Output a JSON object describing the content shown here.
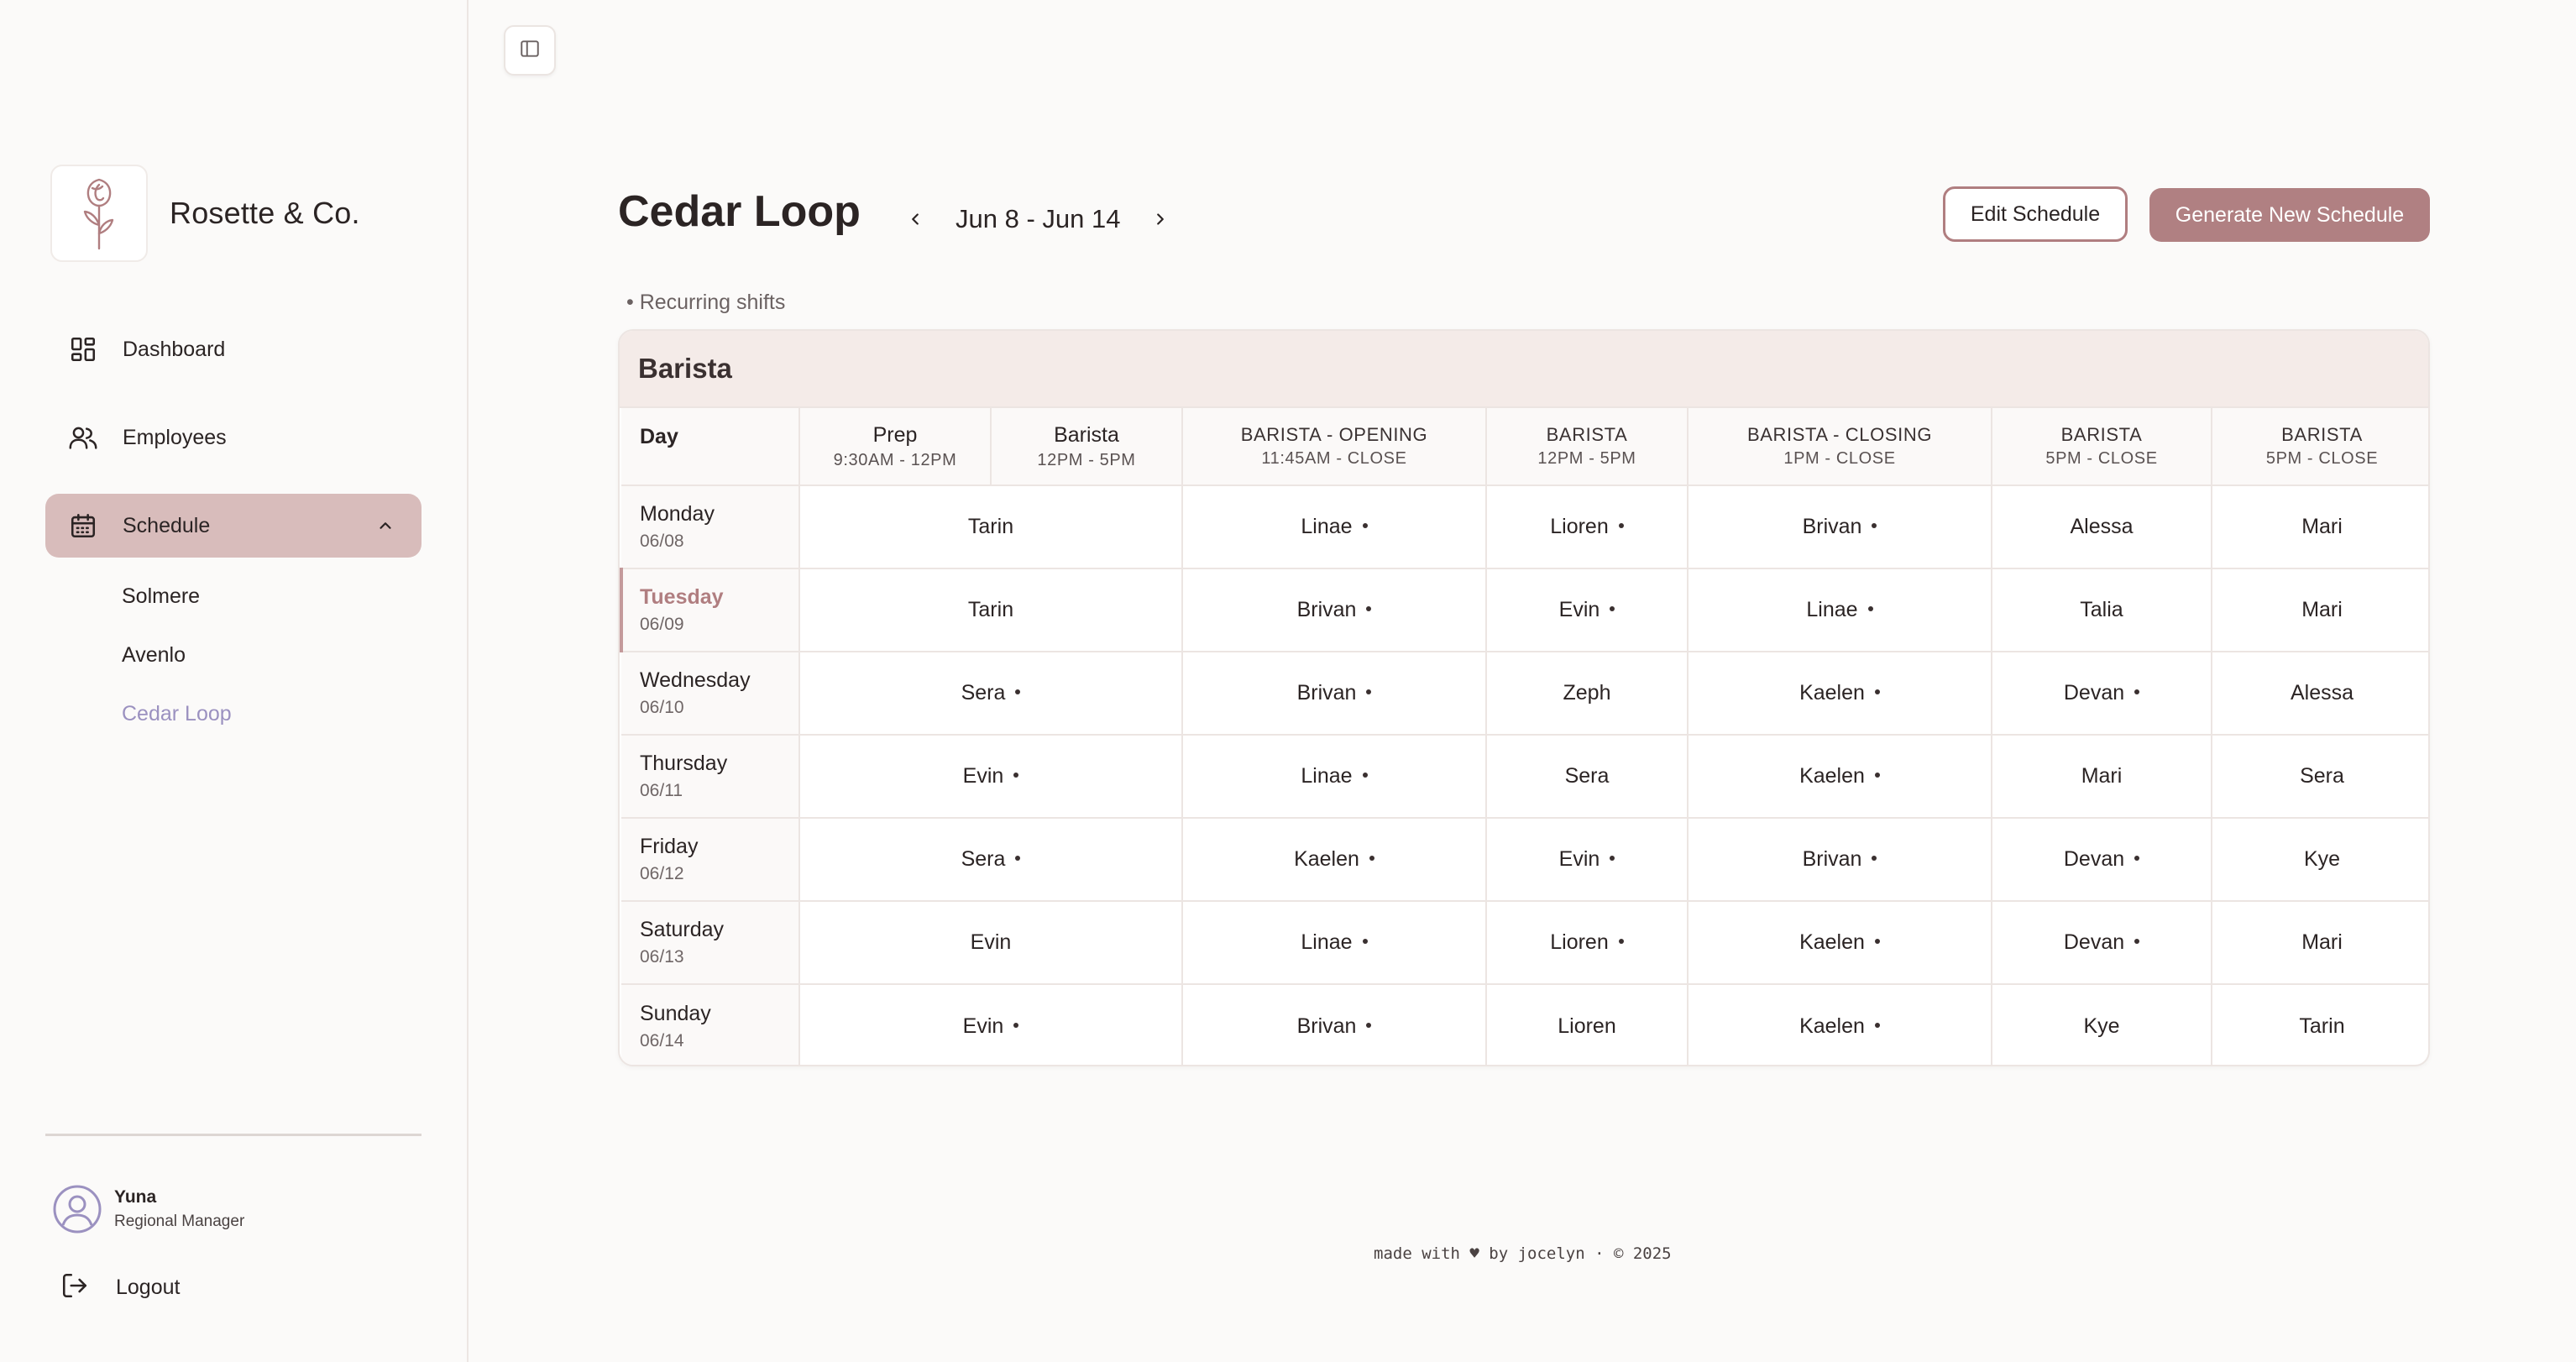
{
  "brand": {
    "name": "Rosette & Co."
  },
  "nav": {
    "items": [
      {
        "label": "Dashboard",
        "icon": "dashboard-icon"
      },
      {
        "label": "Employees",
        "icon": "users-icon"
      },
      {
        "label": "Schedule",
        "icon": "calendar-icon",
        "expanded": true
      }
    ],
    "sub_items": [
      {
        "label": "Solmere"
      },
      {
        "label": "Avenlo"
      },
      {
        "label": "Cedar Loop",
        "current": true
      }
    ]
  },
  "user": {
    "name": "Yuna",
    "role": "Regional Manager"
  },
  "logout": {
    "label": "Logout"
  },
  "header": {
    "title": "Cedar Loop",
    "week": "Jun 8 - Jun 14",
    "edit_label": "Edit Schedule",
    "generate_label": "Generate New Schedule",
    "recurring_note": "• Recurring shifts"
  },
  "colors": {
    "accent": "#b08082",
    "active_nav": "#d8bcbb",
    "current_sub": "#9b91c0",
    "card_head": "#f4ebe8"
  },
  "schedule": {
    "section": "Barista",
    "day_header": "Day",
    "columns": [
      {
        "title": "Prep",
        "time": "9:30AM - 12PM"
      },
      {
        "title": "Barista",
        "time": "12PM - 5PM"
      },
      {
        "title": "BARISTA - OPENING",
        "time": "11:45AM - CLOSE"
      },
      {
        "title": "BARISTA",
        "time": "12PM - 5PM"
      },
      {
        "title": "BARISTA - CLOSING",
        "time": "1PM - CLOSE"
      },
      {
        "title": "BARISTA",
        "time": "5PM - CLOSE"
      },
      {
        "title": "BARISTA",
        "time": "5PM - CLOSE"
      }
    ],
    "rows": [
      {
        "day": "Monday",
        "date": "06/08",
        "today": false,
        "cells": [
          {
            "name": "Tarin",
            "recurring": false
          },
          {
            "name": "Linae",
            "recurring": true
          },
          {
            "name": "Lioren",
            "recurring": true
          },
          {
            "name": "Brivan",
            "recurring": true
          },
          {
            "name": "Alessa",
            "recurring": false
          },
          {
            "name": "Mari",
            "recurring": false
          }
        ]
      },
      {
        "day": "Tuesday",
        "date": "06/09",
        "today": true,
        "cells": [
          {
            "name": "Tarin",
            "recurring": false
          },
          {
            "name": "Brivan",
            "recurring": true
          },
          {
            "name": "Evin",
            "recurring": true
          },
          {
            "name": "Linae",
            "recurring": true
          },
          {
            "name": "Talia",
            "recurring": false
          },
          {
            "name": "Mari",
            "recurring": false
          }
        ]
      },
      {
        "day": "Wednesday",
        "date": "06/10",
        "today": false,
        "cells": [
          {
            "name": "Sera",
            "recurring": true
          },
          {
            "name": "Brivan",
            "recurring": true
          },
          {
            "name": "Zeph",
            "recurring": false
          },
          {
            "name": "Kaelen",
            "recurring": true
          },
          {
            "name": "Devan",
            "recurring": true
          },
          {
            "name": "Alessa",
            "recurring": false
          }
        ]
      },
      {
        "day": "Thursday",
        "date": "06/11",
        "today": false,
        "cells": [
          {
            "name": "Evin",
            "recurring": true
          },
          {
            "name": "Linae",
            "recurring": true
          },
          {
            "name": "Sera",
            "recurring": false
          },
          {
            "name": "Kaelen",
            "recurring": true
          },
          {
            "name": "Mari",
            "recurring": false
          },
          {
            "name": "Sera",
            "recurring": false
          }
        ]
      },
      {
        "day": "Friday",
        "date": "06/12",
        "today": false,
        "cells": [
          {
            "name": "Sera",
            "recurring": true
          },
          {
            "name": "Kaelen",
            "recurring": true
          },
          {
            "name": "Evin",
            "recurring": true
          },
          {
            "name": "Brivan",
            "recurring": true
          },
          {
            "name": "Devan",
            "recurring": true
          },
          {
            "name": "Kye",
            "recurring": false
          }
        ]
      },
      {
        "day": "Saturday",
        "date": "06/13",
        "today": false,
        "cells": [
          {
            "name": "Evin",
            "recurring": false
          },
          {
            "name": "Linae",
            "recurring": true
          },
          {
            "name": "Lioren",
            "recurring": true
          },
          {
            "name": "Kaelen",
            "recurring": true
          },
          {
            "name": "Devan",
            "recurring": true
          },
          {
            "name": "Mari",
            "recurring": false
          }
        ]
      },
      {
        "day": "Sunday",
        "date": "06/14",
        "today": false,
        "cells": [
          {
            "name": "Evin",
            "recurring": true
          },
          {
            "name": "Brivan",
            "recurring": true
          },
          {
            "name": "Lioren",
            "recurring": false
          },
          {
            "name": "Kaelen",
            "recurring": true
          },
          {
            "name": "Kye",
            "recurring": false
          },
          {
            "name": "Tarin",
            "recurring": false
          }
        ]
      }
    ]
  },
  "footer": {
    "text": "made with ♥ by jocelyn · © 2025"
  }
}
